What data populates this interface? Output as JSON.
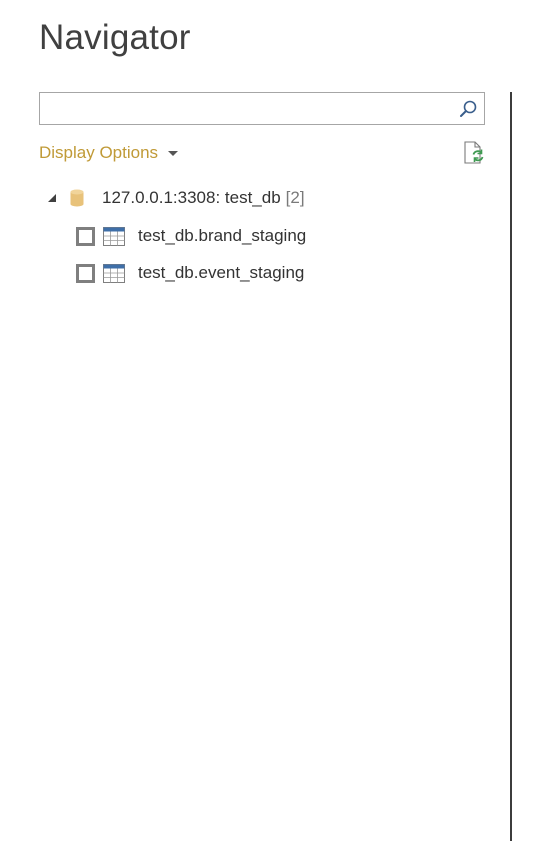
{
  "window": {
    "title": "Navigator"
  },
  "search": {
    "value": "",
    "placeholder": "",
    "icon": "search-icon"
  },
  "toolbar": {
    "display_options_label": "Display Options",
    "refresh_icon": "refresh-document-icon"
  },
  "tree": {
    "root": {
      "label": "127.0.0.1:3308: test_db",
      "count": "[2]",
      "icon": "database-icon",
      "expanded": true
    },
    "items": [
      {
        "label": "test_db.brand_staging",
        "checked": false,
        "icon": "table-icon"
      },
      {
        "label": "test_db.event_staging",
        "checked": false,
        "icon": "table-icon"
      }
    ]
  },
  "colors": {
    "accent": "#c09a37",
    "database": "#e8c27a",
    "table_header": "#3f6fa8",
    "checkbox_border": "#7f7f7f",
    "divider": "#3c3c3c"
  }
}
